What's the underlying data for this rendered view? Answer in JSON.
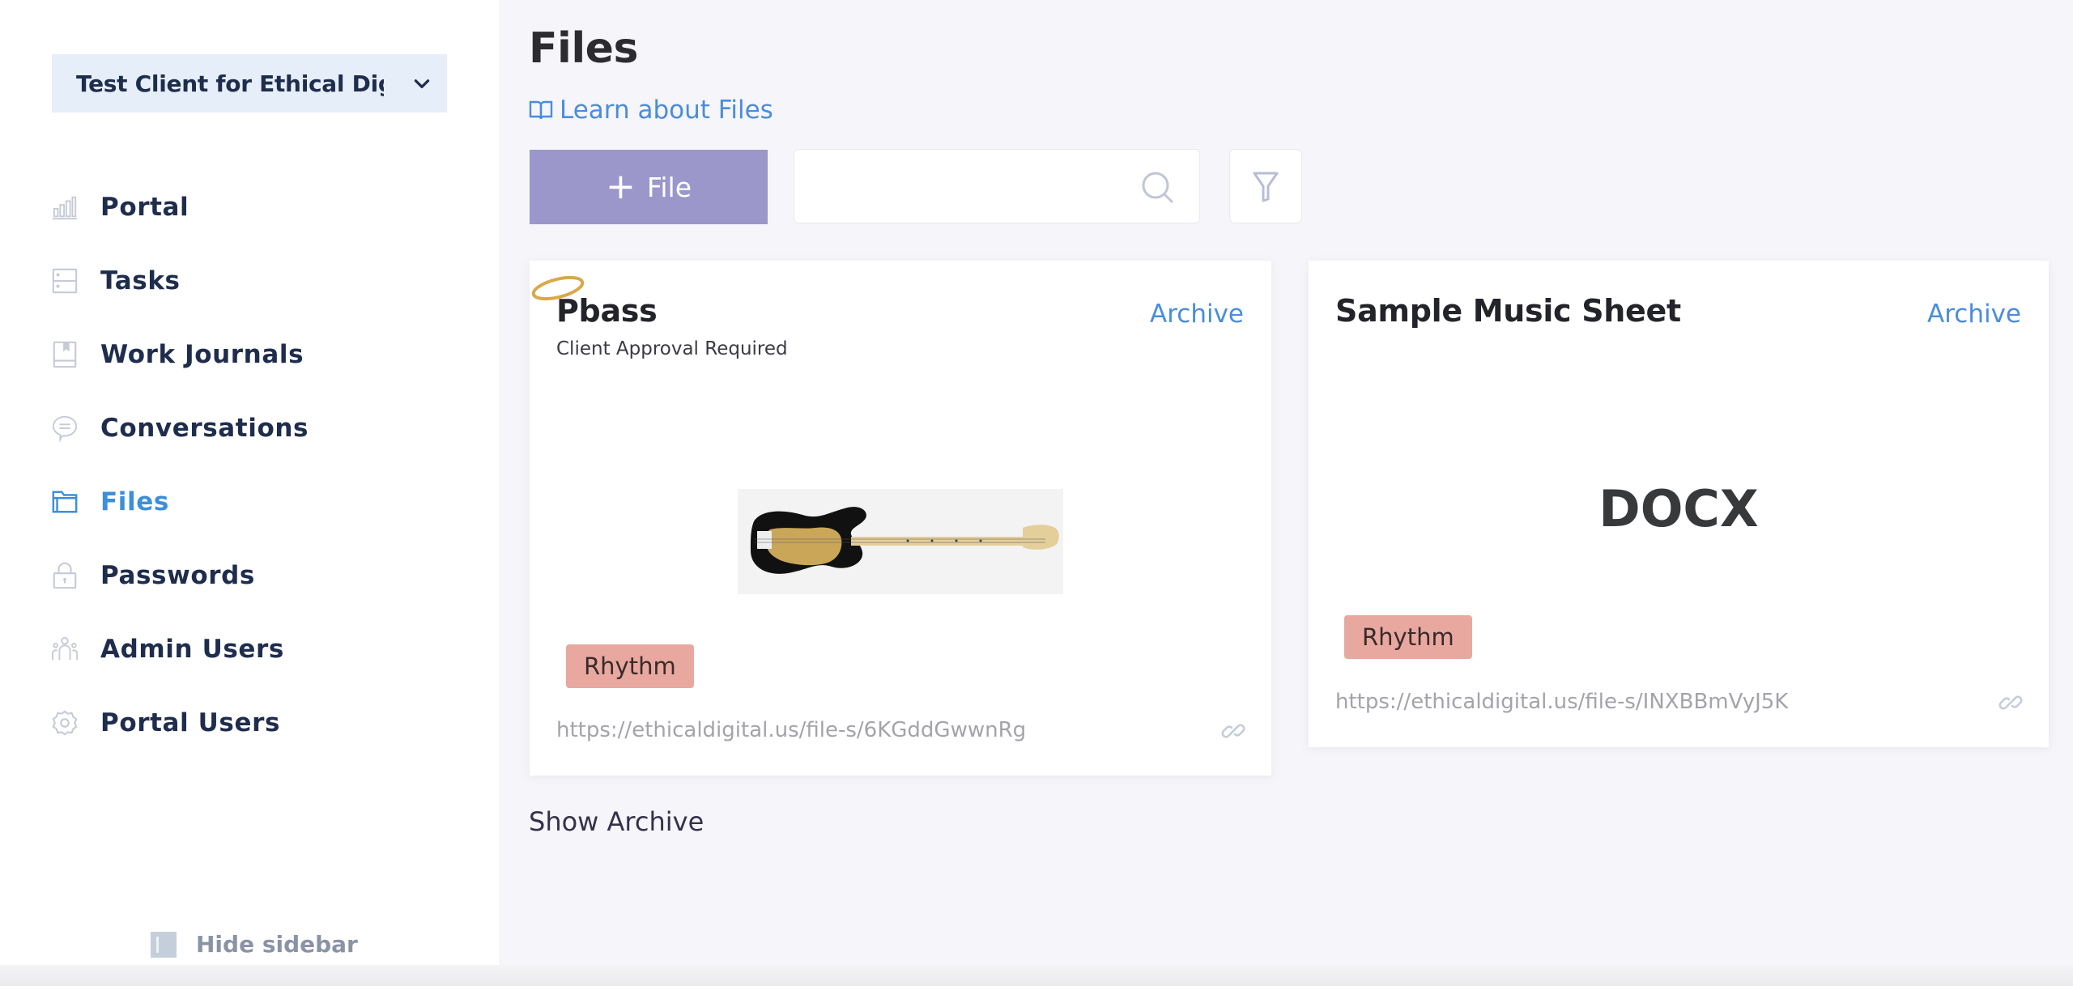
{
  "sidebar": {
    "client_selector": {
      "label": "Test Client for Ethical Digital",
      "icon": "chevron-down-icon"
    },
    "items": [
      {
        "label": "Portal",
        "icon": "bar-chart-icon",
        "active": false
      },
      {
        "label": "Tasks",
        "icon": "tasks-icon",
        "active": false
      },
      {
        "label": "Work Journals",
        "icon": "journal-icon",
        "active": false
      },
      {
        "label": "Conversations",
        "icon": "chat-bubble-icon",
        "active": false
      },
      {
        "label": "Files",
        "icon": "folder-icon",
        "active": true
      },
      {
        "label": "Passwords",
        "icon": "lock-icon",
        "active": false
      },
      {
        "label": "Admin Users",
        "icon": "users-icon",
        "active": false
      },
      {
        "label": "Portal Users",
        "icon": "gear-icon",
        "active": false
      }
    ],
    "hide_sidebar_label": "Hide sidebar"
  },
  "header": {
    "title": "Files",
    "learn_link": "Learn about Files",
    "add_button_label": "File",
    "search": {
      "value": "",
      "placeholder": ""
    }
  },
  "files": [
    {
      "title": "Pbass",
      "subtitle": "Client Approval Required",
      "archive_label": "Archive",
      "preview": "image",
      "preview_alt": "Black precision bass guitar with gold pickguard",
      "tag": "Rhythm",
      "url": "https://ethicaldigital.us/file-s/6KGddGwwnRg"
    },
    {
      "title": "Sample Music Sheet",
      "archive_label": "Archive",
      "preview": "DOCX",
      "tag": "Rhythm",
      "url": "https://ethicaldigital.us/file-s/INXBBmVyJ5K"
    }
  ],
  "show_archive_label": "Show Archive",
  "colors": {
    "accent_blue": "#4a8ddb",
    "add_button": "#9b97cb",
    "tag_bg": "#e8a8a0",
    "nav_text": "#1f2d4d",
    "client_selector_bg": "#e6eef9"
  }
}
